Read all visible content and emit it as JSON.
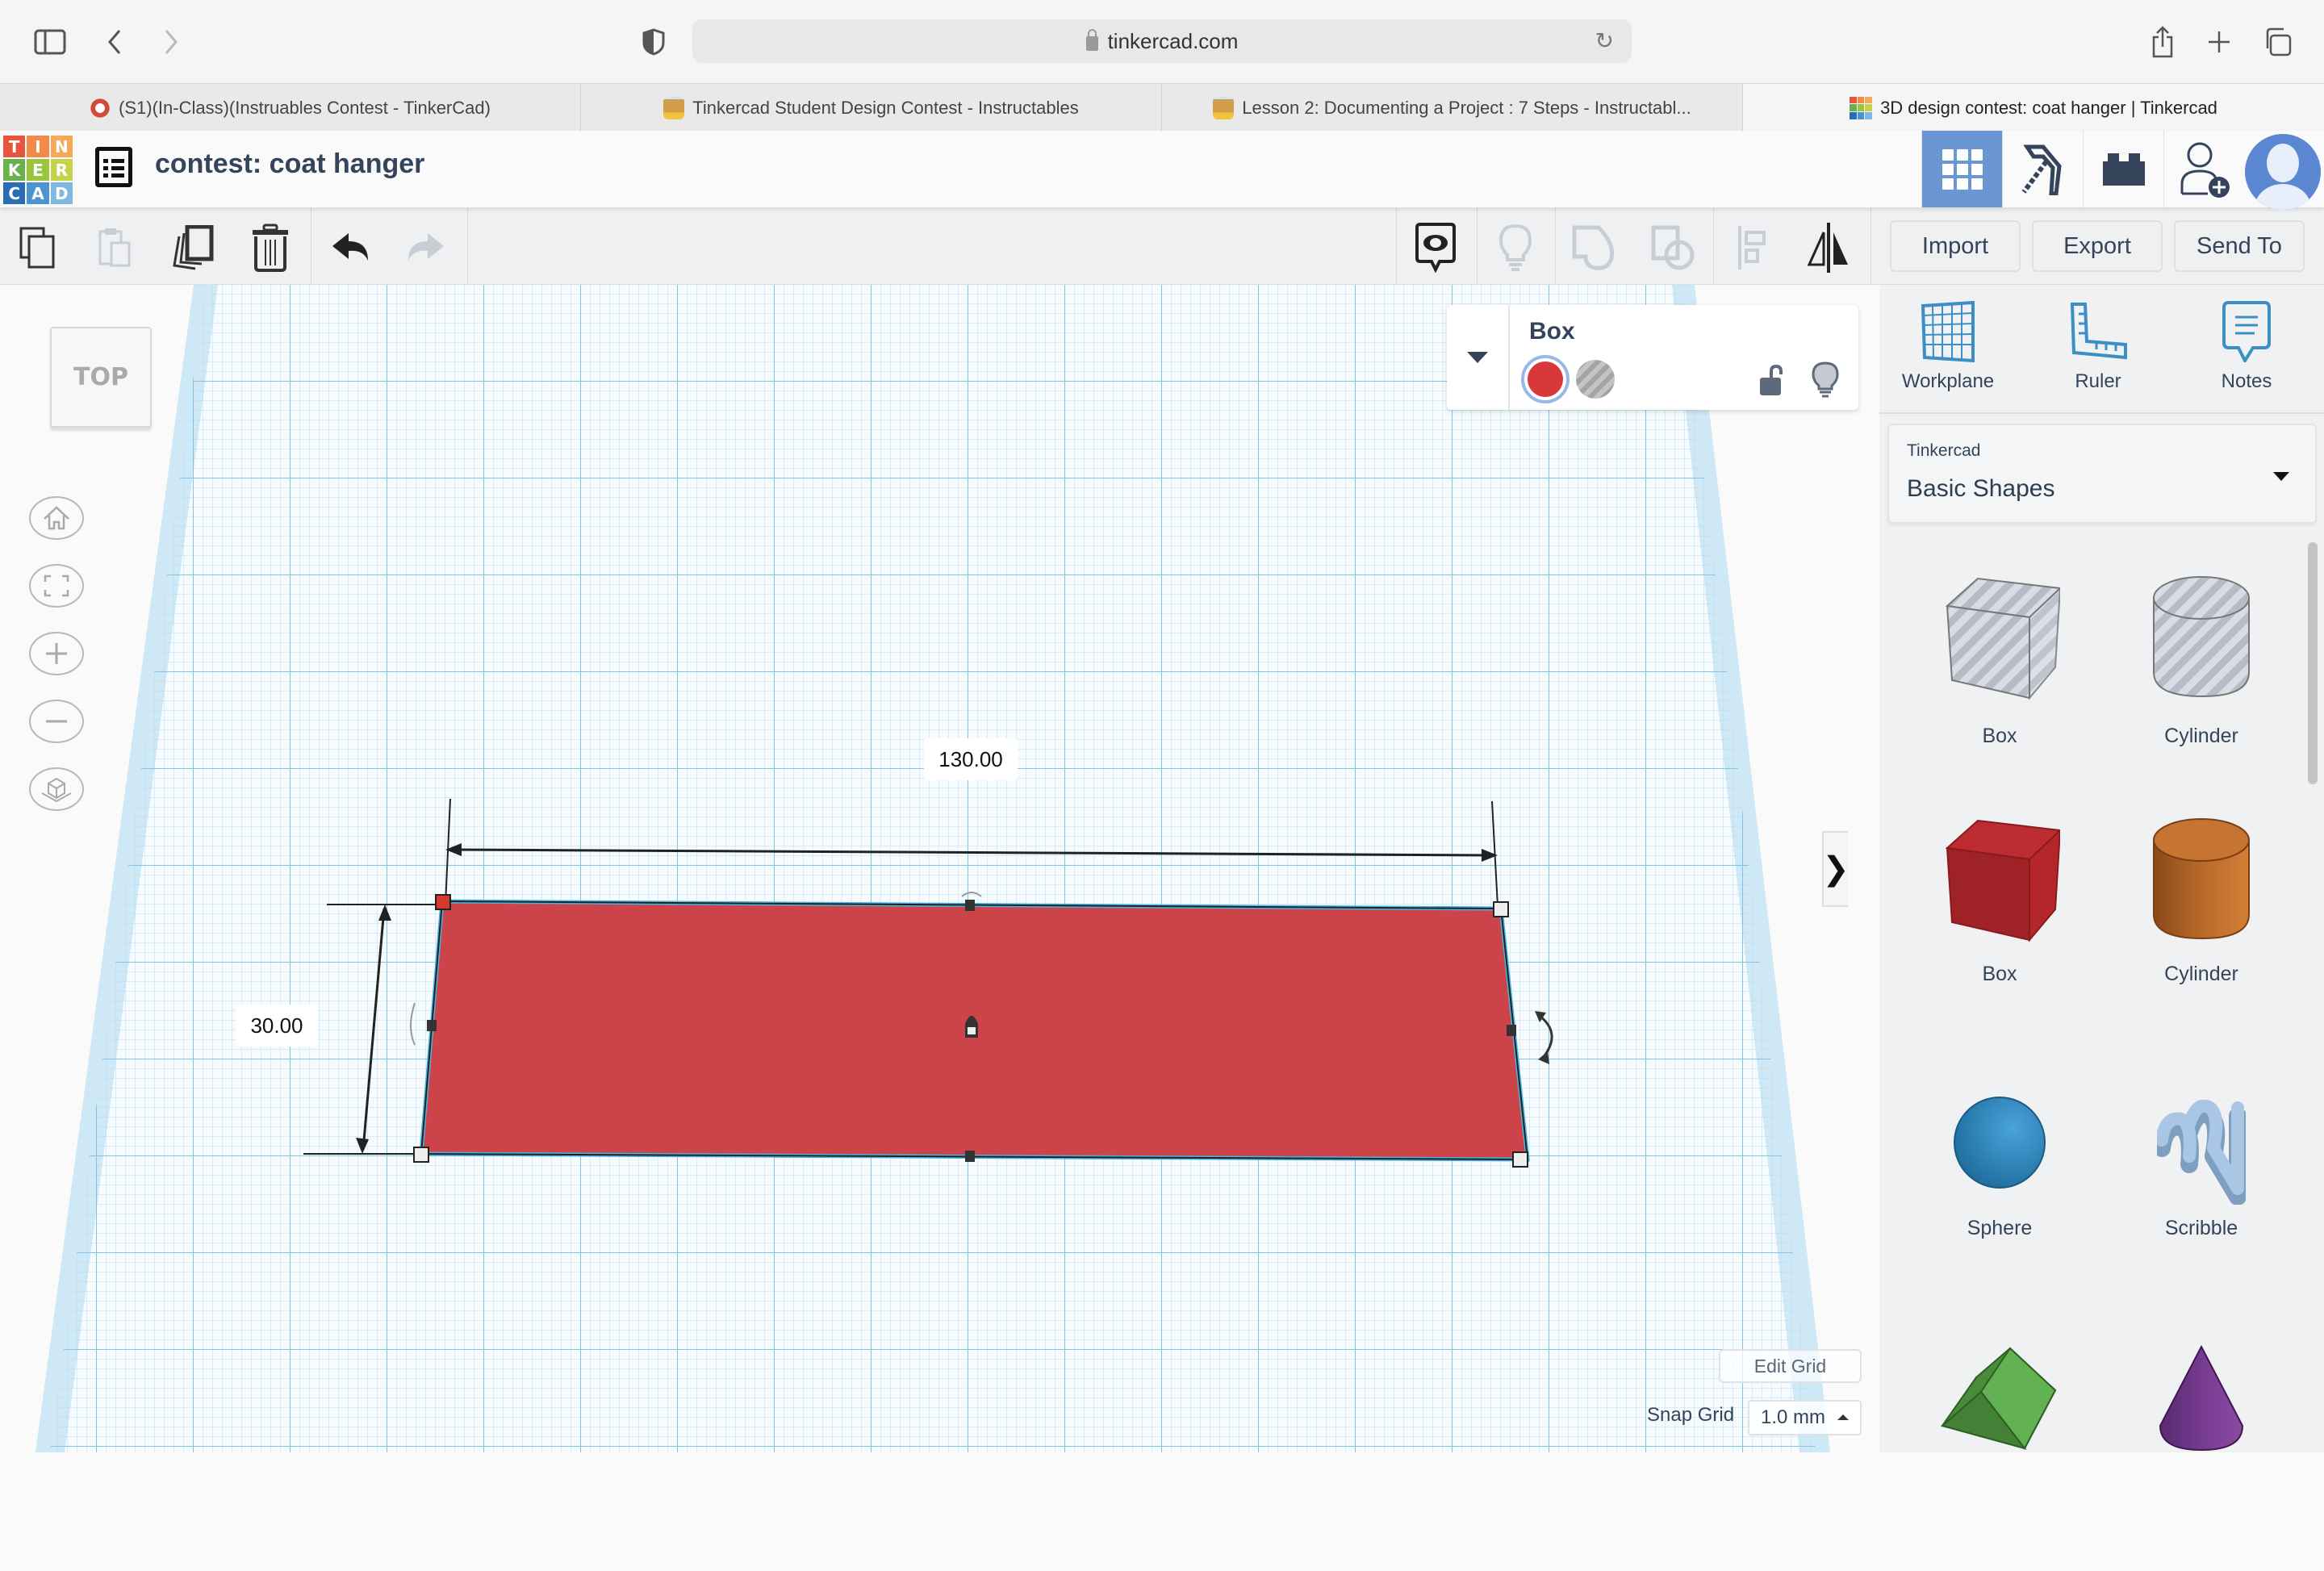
{
  "browser": {
    "url": "tinkercad.com",
    "tabs": [
      {
        "title": "(S1)(In-Class)(Instruables Contest - TinkerCad)",
        "favicon": "canvas-icon",
        "active": false
      },
      {
        "title": "Tinkercad Student Design Contest - Instructables",
        "favicon": "instructables-robot-icon",
        "active": false
      },
      {
        "title": "Lesson 2: Documenting a Project : 7 Steps - Instructabl...",
        "favicon": "instructables-robot-icon",
        "active": false
      },
      {
        "title": "3D design contest: coat hanger | Tinkercad",
        "favicon": "tinkercad-icon",
        "active": true
      }
    ]
  },
  "app": {
    "logo_letters": [
      "T",
      "I",
      "N",
      "K",
      "E",
      "R",
      "C",
      "A",
      "D"
    ],
    "logo_colors": [
      "#e8553e",
      "#f28b4a",
      "#f5a855",
      "#6ab04c",
      "#9bc53d",
      "#c4d34a",
      "#2a6db5",
      "#4b93d1",
      "#7fb8e0"
    ],
    "design_title": "contest: coat hanger",
    "header_buttons": [
      "3d-design-view",
      "codeblocks-pickaxe",
      "lego-bricks",
      "invite-user"
    ],
    "active_view_color": "#6a96d4"
  },
  "toolbar": {
    "left_tools": [
      "copy",
      "paste",
      "duplicate",
      "delete",
      "undo",
      "redo"
    ],
    "disabled": [
      "paste",
      "redo",
      "hide",
      "group",
      "ungroup",
      "align"
    ],
    "right_tools": [
      "show-notes",
      "hide",
      "group",
      "ungroup",
      "align",
      "mirror"
    ],
    "import_label": "Import",
    "export_label": "Export",
    "send_to_label": "Send To"
  },
  "viewport": {
    "viewcube_label": "TOP",
    "nav_buttons": [
      "home-view",
      "fit-all",
      "zoom-in",
      "zoom-out",
      "perspective"
    ],
    "selected_shape": {
      "name": "Box",
      "color": "#cc4449",
      "width_label": "130.00",
      "depth_label": "30.00"
    },
    "edit_grid_label": "Edit Grid",
    "snap_grid_label": "Snap Grid",
    "snap_grid_value": "1.0 mm"
  },
  "inspector": {
    "title": "Box",
    "solid_color": "#d8383a",
    "mode": "solid"
  },
  "sidebar": {
    "tools": [
      {
        "label": "Workplane",
        "icon": "workplane-icon"
      },
      {
        "label": "Ruler",
        "icon": "ruler-icon"
      },
      {
        "label": "Notes",
        "icon": "notes-icon"
      }
    ],
    "library_provider": "Tinkercad",
    "library_name": "Basic Shapes",
    "shapes": [
      {
        "label": "Box",
        "kind": "box-hole"
      },
      {
        "label": "Cylinder",
        "kind": "cylinder-hole"
      },
      {
        "label": "Box",
        "kind": "box"
      },
      {
        "label": "Cylinder",
        "kind": "cylinder"
      },
      {
        "label": "Sphere",
        "kind": "sphere"
      },
      {
        "label": "Scribble",
        "kind": "scribble"
      },
      {
        "label": "",
        "kind": "roof"
      },
      {
        "label": "",
        "kind": "cone"
      }
    ],
    "collapse_glyph": "❯"
  }
}
